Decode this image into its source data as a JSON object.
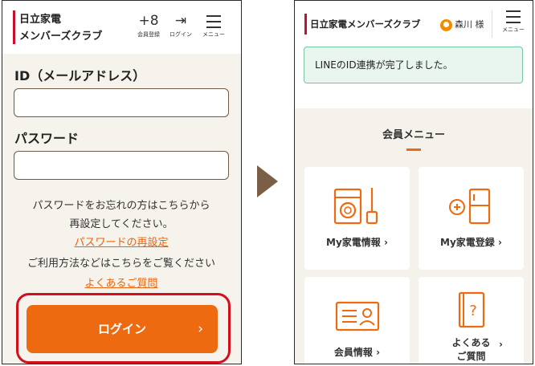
{
  "left_screen": {
    "brand_line1": "日立家電",
    "brand_line2": "メンバーズクラブ",
    "header_icons": [
      {
        "glyph": "+8",
        "label": "会員登録",
        "icon": "member-register-icon"
      },
      {
        "glyph": "⇥",
        "label": "ログイン",
        "icon": "login-icon"
      },
      {
        "glyph": "",
        "label": "メニュー",
        "icon": "hamburger-menu-icon"
      }
    ],
    "id_label": "ID（メールアドレス）",
    "id_value": "",
    "password_label": "パスワード",
    "password_value": "",
    "forgot_text_line1": "パスワードをお忘れの方はこちらから",
    "forgot_text_line2": "再設定してください。",
    "reset_link": "パスワードの再設定",
    "usage_text": "ご利用方法などはこちらをご覧ください",
    "faq_link": "よくあるご質問",
    "login_button": "ログイン",
    "login_chevron": "›"
  },
  "right_screen": {
    "brand": "日立家電メンバーズクラブ",
    "user_name": "森川 様",
    "menu_label": "メニュー",
    "notice": "LINEのID連携が完了しました。",
    "section_title": "会員メニュー",
    "cards": [
      {
        "label": "My家電情報",
        "chevron": "›",
        "icon": "appliance-info-icon"
      },
      {
        "label": "My家電登録",
        "chevron": "›",
        "icon": "appliance-register-icon"
      },
      {
        "label": "会員情報",
        "chevron": "›",
        "icon": "member-info-icon"
      },
      {
        "label_line1": "よくある",
        "label_line2": "ご質問",
        "chevron": "›",
        "icon": "faq-book-icon"
      }
    ]
  },
  "colors": {
    "accent": "#ee6a10",
    "brand_red": "#c8102e",
    "highlight_ring": "#d40f1c",
    "arrow": "#7a5e45"
  }
}
